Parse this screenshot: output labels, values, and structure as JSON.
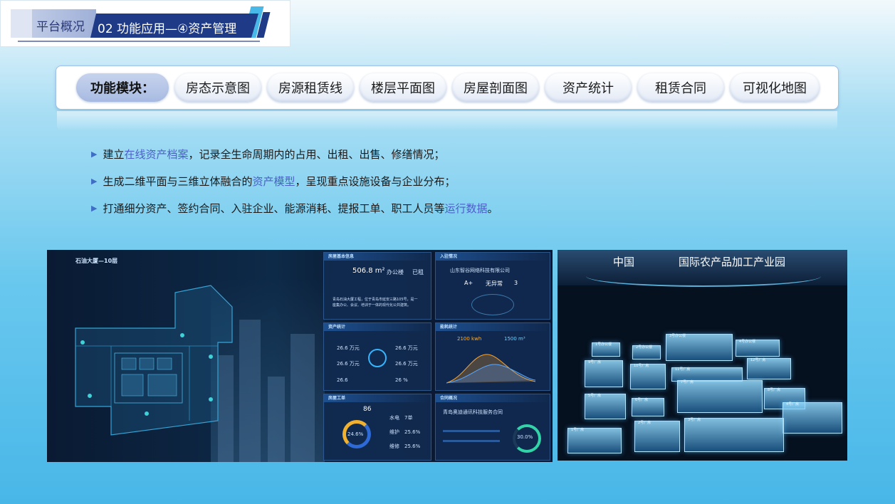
{
  "header": {
    "section_label": "平台概况",
    "title": "02 功能应用—④资产管理"
  },
  "modules": {
    "title": "功能模块：",
    "items": [
      {
        "label": "房态示意图"
      },
      {
        "label": "房源租赁线"
      },
      {
        "label": "楼层平面图"
      },
      {
        "label": "房屋剖面图"
      },
      {
        "label": "资产统计"
      },
      {
        "label": "租赁合同"
      },
      {
        "label": "可视化地图"
      }
    ]
  },
  "bullets": [
    {
      "pre": "建立",
      "hl": "在线资产档案",
      "post": "，记录全生命周期内的占用、出租、出售、修缮情况；"
    },
    {
      "pre": "生成二维平面与三维立体融合的",
      "hl": "资产模型",
      "post": "，呈现重点设施设备与企业分布；"
    },
    {
      "pre": "打通细分资产、签约合同、入驻企业、能源消耗、提报工单、职工人员等",
      "hl": "运行数据",
      "post": "。"
    }
  ],
  "left_screenshot": {
    "floor_title": "石油大厦—10层",
    "basic_info": {
      "area": "506.8 m²",
      "type": "办公楼",
      "status": "已租"
    },
    "tenant": {
      "name": "山东智谷网络科技有限公司",
      "rating": "A+",
      "exception": "无异常",
      "count": "3"
    },
    "energy": {
      "power": "2100 kwh",
      "water": "1500 m³"
    },
    "workorder": {
      "total": "86",
      "rate": "24.6%",
      "repair": "30.0%"
    }
  },
  "right_screenshot": {
    "title_left": "中国",
    "title_right": "国际农产品加工产业园",
    "buildings": [
      "1号办公楼",
      "2号办公楼",
      "3号办公楼",
      "4号办公楼",
      "9号厂房",
      "10号厂房",
      "11号厂房",
      "12号厂房",
      "7号厂房",
      "8号厂房",
      "5号厂房",
      "6号厂房",
      "4号厂房",
      "1号厂房",
      "2号厂房",
      "3号厂房"
    ]
  },
  "colors": {
    "accent": "#4a5fc8",
    "header_dark": "#1f3a86",
    "header_light": "#47b8e8"
  }
}
